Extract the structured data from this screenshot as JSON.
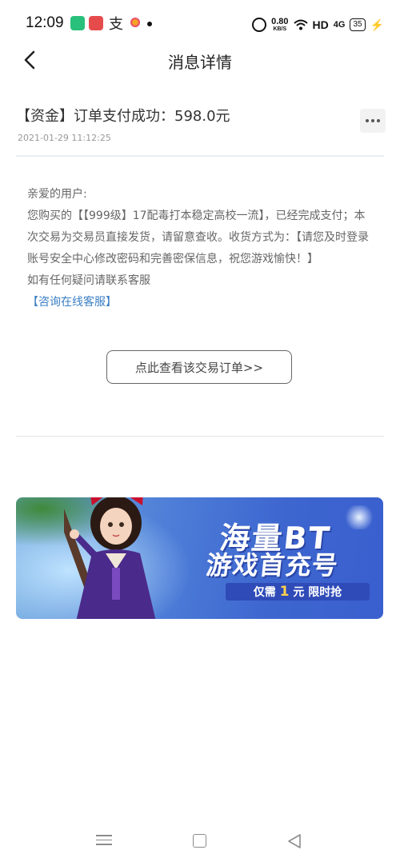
{
  "status_bar": {
    "time": "12:09",
    "net_speed_value": "0.80",
    "net_speed_unit": "KB/S",
    "hd": "HD",
    "signal": "4G",
    "battery": "35",
    "app3_glyph": "支"
  },
  "nav": {
    "title": "消息详情"
  },
  "message": {
    "title": "【资金】订单支付成功：598.0元",
    "timestamp": "2021-01-29 11:12:25",
    "greeting": "亲爱的用户:",
    "body": "您购买的【【999级】17配毒打本稳定高校一流】，已经完成支付；本次交易为交易员直接发货，请留意查收。收货方式为：【请您及时登录账号安全中心修改密码和完善密保信息，祝您游戏愉快！】",
    "contact_note": "如有任何疑问请联系客服",
    "service_link": "【咨询在线客服】"
  },
  "actions": {
    "view_order": "点此查看该交易订单>>"
  },
  "banner": {
    "headline1": "海量BT",
    "headline2": "游戏首充号",
    "tag_prefix": "仅需",
    "tag_highlight": "1",
    "tag_suffix": "元 限时抢"
  },
  "colors": {
    "link": "#3a7fc4",
    "banner_blue": "#3d66cf"
  }
}
